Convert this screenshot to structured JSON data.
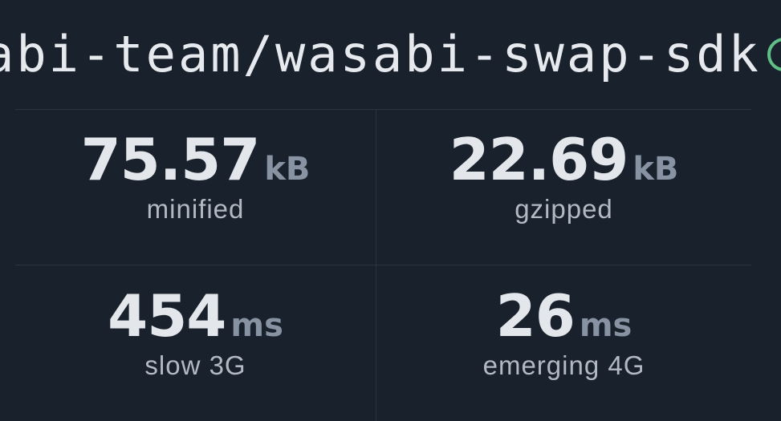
{
  "package": {
    "name": "abi-team/wasabi-swap-sdk",
    "status_color": "#5fbf86"
  },
  "stats": {
    "minified": {
      "value": "75.57",
      "unit": "kB",
      "label": "minified"
    },
    "gzipped": {
      "value": "22.69",
      "unit": "kB",
      "label": "gzipped"
    },
    "slow3g": {
      "value": "454",
      "unit": "ms",
      "label": "slow 3G"
    },
    "emerging4g": {
      "value": "26",
      "unit": "ms",
      "label": "emerging 4G"
    }
  }
}
